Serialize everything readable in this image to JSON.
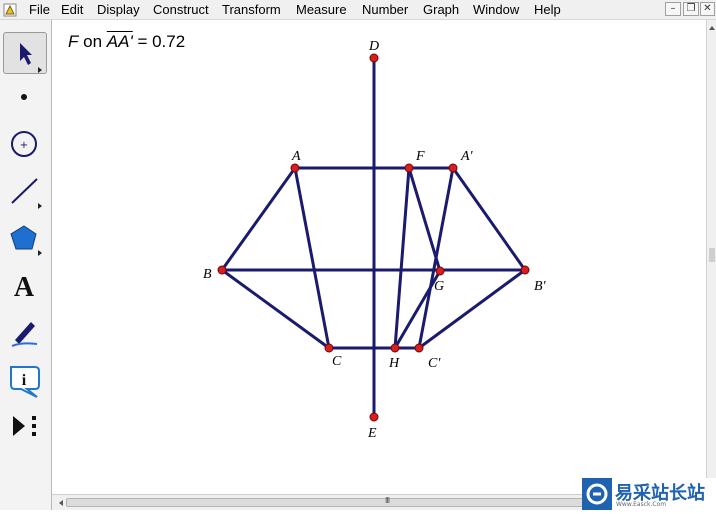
{
  "menu": [
    "File",
    "Edit",
    "Display",
    "Construct",
    "Transform",
    "Measure",
    "Number",
    "Graph",
    "Window",
    "Help"
  ],
  "window_buttons": {
    "minimize": "–",
    "restore": "❐",
    "close": "✕"
  },
  "tools": [
    "arrow-select-tool",
    "point-tool",
    "compass-tool",
    "straightedge-tool",
    "polygon-tool",
    "text-tool",
    "marker-tool",
    "information-tool",
    "custom-tool"
  ],
  "text_tool_glyph": "A",
  "info_tool_glyph": "i",
  "measurement": {
    "point": "F",
    "on": "on",
    "segment": "AA'",
    "equals": "= 0.72"
  },
  "points": [
    {
      "id": "A",
      "label": "A"
    },
    {
      "id": "F",
      "label": "F"
    },
    {
      "id": "A'",
      "label": "A'"
    },
    {
      "id": "B",
      "label": "B"
    },
    {
      "id": "G",
      "label": "G"
    },
    {
      "id": "B'",
      "label": "B'"
    },
    {
      "id": "C",
      "label": "C"
    },
    {
      "id": "H",
      "label": "H"
    },
    {
      "id": "C'",
      "label": "C'"
    },
    {
      "id": "D",
      "label": "D"
    },
    {
      "id": "E",
      "label": "E"
    }
  ],
  "segments": [
    [
      "A",
      "A'"
    ],
    [
      "B",
      "B'"
    ],
    [
      "C",
      "C'"
    ],
    [
      "D",
      "E"
    ],
    [
      "A",
      "B"
    ],
    [
      "B",
      "C"
    ],
    [
      "A",
      "C"
    ],
    [
      "A'",
      "B'"
    ],
    [
      "B'",
      "C'"
    ],
    [
      "A'",
      "C'"
    ],
    [
      "F",
      "H"
    ],
    [
      "F",
      "G"
    ],
    [
      "G",
      "H"
    ]
  ],
  "scrollbar": {
    "grip": "III"
  },
  "watermark": {
    "brand": "易采站长站",
    "sub": "Www.Easck.Com"
  },
  "colors": {
    "segment": "#1a1a6e",
    "point_fill": "#d42020",
    "point_stroke": "#7a0000",
    "toolbar_bg": "#f3f3f3",
    "watermark_blue": "#1f62b0"
  }
}
